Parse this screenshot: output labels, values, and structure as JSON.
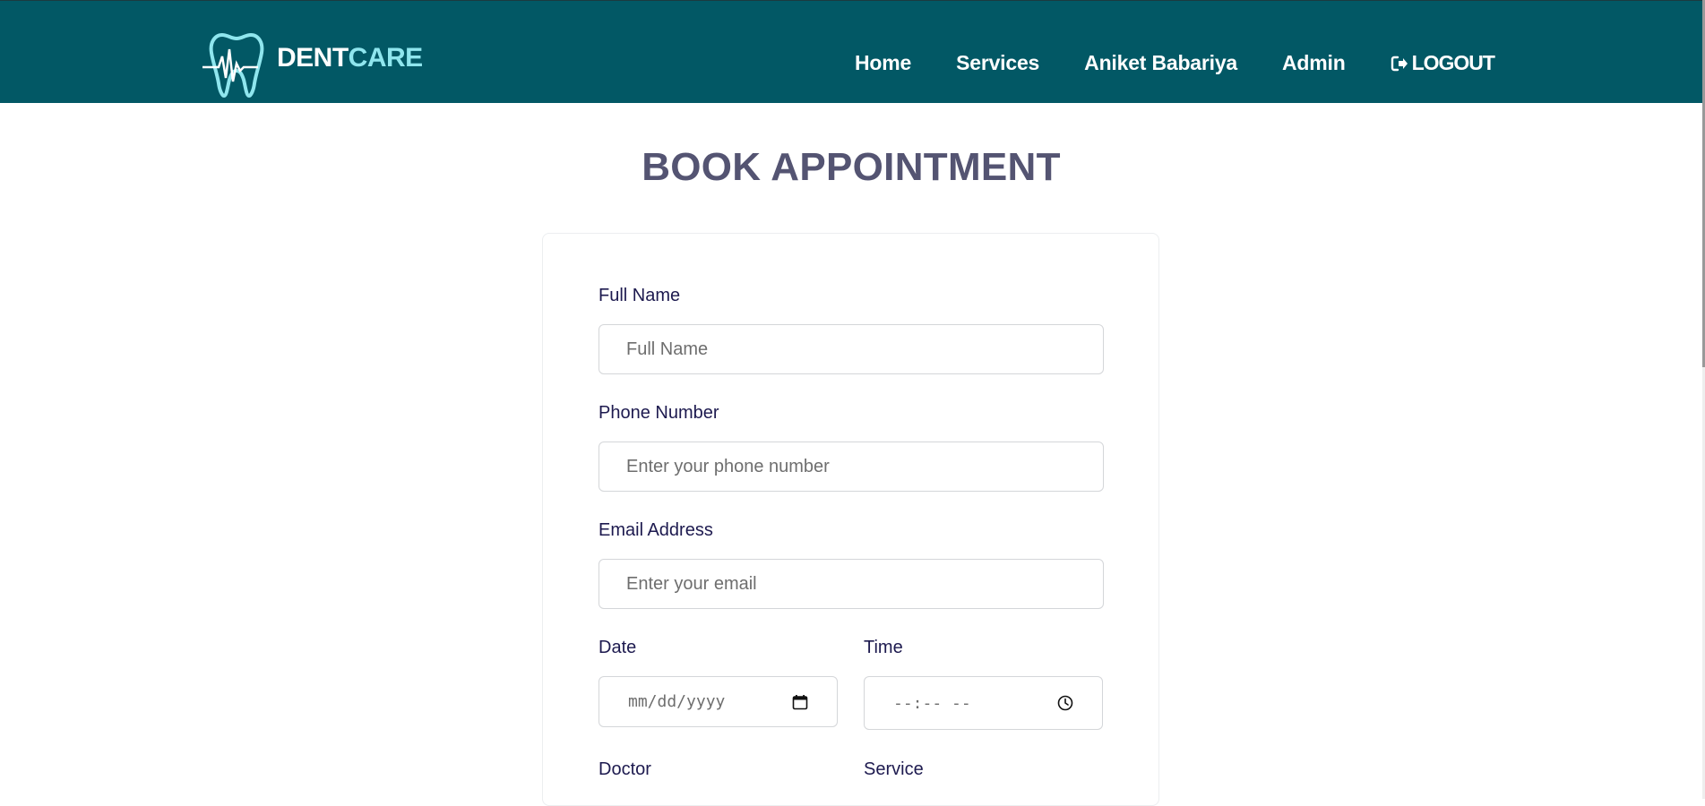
{
  "brand": {
    "name_part1": "DENT",
    "name_part2": "CARE",
    "accent": "#8fe6ee",
    "header_bg": "#025865"
  },
  "nav": {
    "home": "Home",
    "services": "Services",
    "user": "Aniket Babariya",
    "admin": "Admin",
    "logout": "LOGOUT"
  },
  "page": {
    "title": "BOOK APPOINTMENT"
  },
  "form": {
    "full_name": {
      "label": "Full Name",
      "placeholder": "Full Name",
      "value": ""
    },
    "phone": {
      "label": "Phone Number",
      "placeholder": "Enter your phone number",
      "value": ""
    },
    "email": {
      "label": "Email Address",
      "placeholder": "Enter your email",
      "value": ""
    },
    "date": {
      "label": "Date",
      "display": "mm/dd/yyyy"
    },
    "time": {
      "label": "Time",
      "display": "--:-- --"
    },
    "doctor": {
      "label": "Doctor"
    },
    "service": {
      "label": "Service"
    }
  }
}
